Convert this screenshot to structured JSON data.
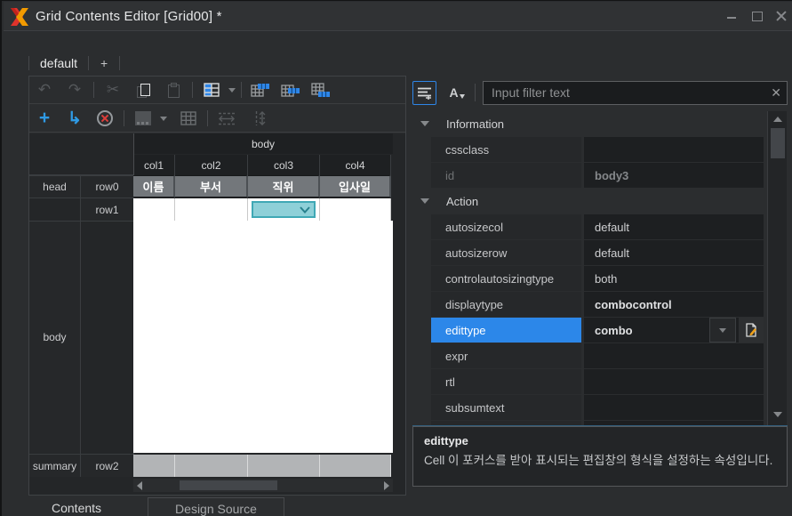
{
  "window": {
    "title": "Grid Contents Editor [Grid00] *"
  },
  "view_tabs": {
    "active_label": "default",
    "add_label": "+"
  },
  "icons": {
    "undo": "↶",
    "redo": "↷",
    "cut": "✂",
    "add": "+",
    "move_arrow": "↳",
    "sort_alpha": "A",
    "filter_clear": "✕"
  },
  "toolbar": {
    "row1": [
      "undo",
      "redo",
      "cut",
      "copy",
      "paste",
      "select-table",
      "head-band",
      "body-band",
      "summary-band"
    ],
    "row2": [
      "add-cell",
      "move-cell",
      "delete-cell",
      "merge-cells",
      "split-cells",
      "column-width",
      "row-height"
    ]
  },
  "grid": {
    "band_title": "body",
    "column_ids": [
      "col1",
      "col2",
      "col3",
      "col4"
    ],
    "row_labels": {
      "head_band": "head",
      "head_row": "row0",
      "body_row": "row1",
      "body_band": "body",
      "summary_band": "summary",
      "summary_row": "row2"
    },
    "head_cells": [
      "이름",
      "부서",
      "직위",
      "입사일"
    ],
    "combo_cell_column": "col3"
  },
  "property_panel": {
    "filter": {
      "placeholder": "Input filter text"
    },
    "sections": [
      {
        "label": "Information",
        "rows": [
          {
            "name": "cssclass",
            "value": ""
          },
          {
            "name": "id",
            "value": "body3",
            "disabled": true,
            "bold": true
          }
        ]
      },
      {
        "label": "Action",
        "rows": [
          {
            "name": "autosizecol",
            "value": "default"
          },
          {
            "name": "autosizerow",
            "value": "default"
          },
          {
            "name": "controlautosizingtype",
            "value": "both"
          },
          {
            "name": "displaytype",
            "value": "combocontrol",
            "bold": true
          },
          {
            "name": "edittype",
            "value": "combo",
            "bold": true,
            "selected": true,
            "buttons": [
              "dropdown",
              "editor"
            ]
          },
          {
            "name": "expr",
            "value": ""
          },
          {
            "name": "rtl",
            "value": ""
          },
          {
            "name": "subsumtext",
            "value": ""
          }
        ]
      }
    ],
    "description": {
      "title": "edittype",
      "text": "Cell 이 포커스를 받아 표시되는 편집창의 형식을 설정하는 속성입니다."
    }
  },
  "bottom_tabs": [
    {
      "label": "Contents",
      "active": true
    },
    {
      "label": "Design Source",
      "active": false
    }
  ],
  "colors": {
    "accent_blue": "#2e86e8",
    "selection_teal": "#8ed0d8",
    "logo_red": "#e0332b",
    "logo_orange": "#f29a00",
    "delete_red": "#dd3f3c",
    "header_gray": "#73777b",
    "summary_gray": "#b2b4b6"
  }
}
